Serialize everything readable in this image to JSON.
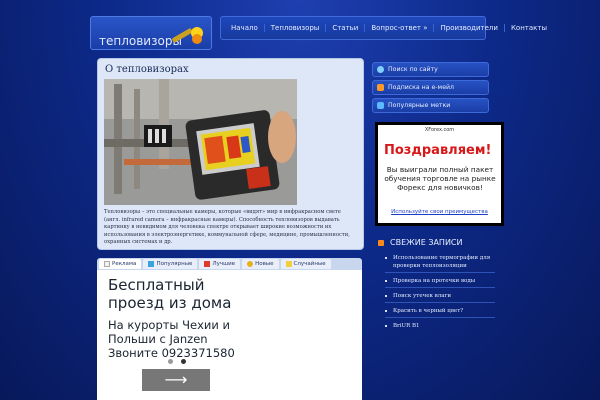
{
  "site": {
    "logo_text": "тепловизоры"
  },
  "nav": [
    "Начало",
    "Тепловизоры",
    "Статьи",
    "Вопрос-ответ »",
    "Производители",
    "Контакты"
  ],
  "post": {
    "title": "О тепловизорах",
    "text": "Тепловизоры – это специальные камеры, которые «видят» мир в инфракрасном свете (англ. infrared camera – инфракрасные камеры). Способность тепловизоров выдавать картинку в невидимом для человека спектре открывает широкие возможности их использования в электроэнергетике, коммунальной сфере, медицине, промышленности, охранных системах и др."
  },
  "tabs": [
    "Реклама",
    "Популярные",
    "Лучшие",
    "Новые",
    "Случайные"
  ],
  "ad_left": {
    "title": "Бесплатный проезд из дома",
    "body": "На курорты Чехии и Польши с Janzen Звоните 0923371580"
  },
  "sidebar_buttons": [
    "Поиск по сайту",
    "Подписка на e-мейл",
    "Популярные метки"
  ],
  "ad_right": {
    "brand": "XForex.com",
    "congrats": "Поздравляем!",
    "message": "Вы выиграли полный пакет обучения торговле на рынке Форекс для новичков!",
    "link": "Используйте свои преимущества"
  },
  "recent": {
    "heading": "СВЕЖИЕ ЗАПИСИ",
    "items": [
      "Использование термографии для проверки теплоизоляции",
      "Проверка на протечки воды",
      "Поиск утечек влаги",
      "Красить в черный цвет?",
      "BriUR B1"
    ]
  },
  "colors": {
    "accent_orange": "#ff8a1a",
    "bg_blue": "#0d2a8a",
    "ad_red": "#d81818"
  }
}
